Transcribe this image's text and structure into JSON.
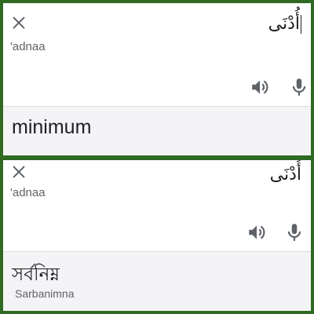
{
  "panels": [
    {
      "source_text": "أُدْنَى",
      "source_transliteration": "'adnaa",
      "translation": "minimum",
      "translation_transliteration": ""
    },
    {
      "source_text": "أُدْنَى",
      "source_transliteration": "'adnaa",
      "translation": "সর্বনিম্ন",
      "translation_transliteration": "Sarbanimna"
    }
  ],
  "icons": {
    "close": "close-icon",
    "speaker": "speaker-icon",
    "mic": "mic-icon"
  },
  "colors": {
    "frame_border": "#2f6a22",
    "icon": "#5f6368",
    "result_background": "#f4f4f6"
  }
}
